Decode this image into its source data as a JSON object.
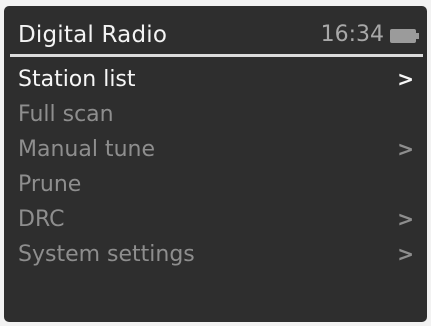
{
  "header": {
    "title": "Digital Radio",
    "time": "16:34",
    "battery_icon": "battery-icon"
  },
  "menu": {
    "items": [
      {
        "label": "Station list",
        "chevron": ">",
        "selected": true
      },
      {
        "label": "Full scan",
        "chevron": "",
        "selected": false
      },
      {
        "label": "Manual tune",
        "chevron": ">",
        "selected": false
      },
      {
        "label": "Prune",
        "chevron": "",
        "selected": false
      },
      {
        "label": "DRC",
        "chevron": ">",
        "selected": false
      },
      {
        "label": "System settings",
        "chevron": ">",
        "selected": false
      }
    ]
  },
  "colors": {
    "screen_background": "#2e2e2e",
    "selected_text": "#f7f7f7",
    "inactive_text": "#8e8e8e"
  }
}
